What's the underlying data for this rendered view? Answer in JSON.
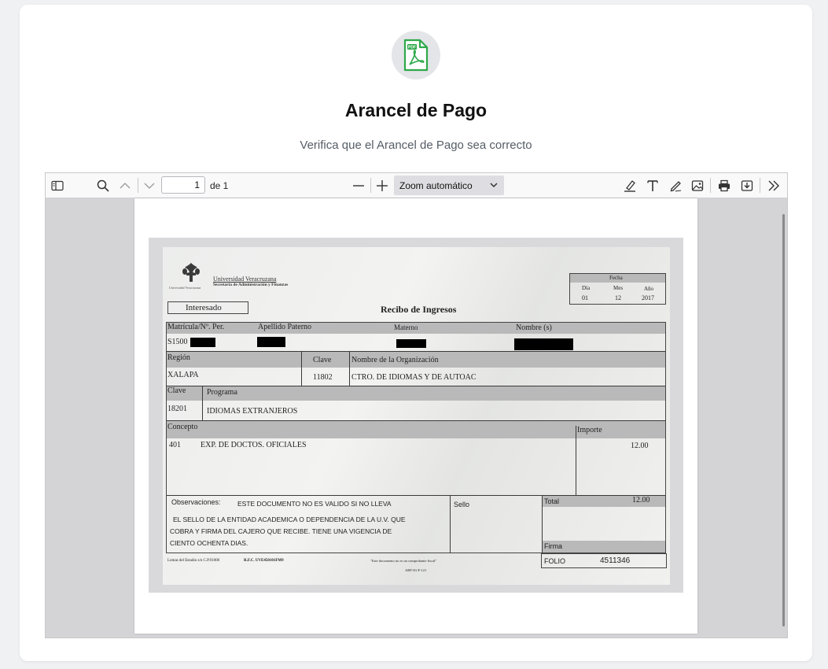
{
  "header": {
    "icon": "pdf-file-icon",
    "title": "Arancel de Pago",
    "subtitle": "Verifica que el Arancel de Pago sea correcto",
    "accent_color": "#2ea84a"
  },
  "viewer": {
    "page_current": "1",
    "page_total_label": "de 1",
    "zoom_label": "Zoom automático",
    "tools": [
      "sidebar-toggle-icon",
      "search-icon",
      "previous-page-icon",
      "next-page-icon",
      "zoom-out-icon",
      "zoom-in-icon",
      "highlight-icon",
      "text-icon",
      "draw-icon",
      "image-icon",
      "print-icon",
      "download-icon",
      "more-tools-icon"
    ]
  },
  "document": {
    "university": "Universidad Veracruzana",
    "department": "Secretaría de Administración y Finanzas",
    "seal_caption": "Universidad Veracruzana",
    "fecha_label": "Fecha",
    "dia_label": "Día",
    "mes_label": "Mes",
    "anio_label": "Año",
    "dia": "01",
    "mes": "12",
    "anio": "2017",
    "interesado": "Interesado",
    "receipt_title": "Recibo de Ingresos",
    "matricula_label": "Matrícula/Nº. Per.",
    "apellido_label": "Apellido Paterno",
    "materno_label": "Materno",
    "nombre_label": "Nombre (s)",
    "matricula_value": "S1500",
    "region_label": "Región",
    "clave_label": "Clave",
    "org_label": "Nombre de la Organización",
    "region_value": "XALAPA",
    "clave_value": "11802",
    "org_value": "CTRO. DE IDIOMAS Y DE AUTOAC",
    "clave2_label": "Clave",
    "programa_label": "Programa",
    "clave2_value": "18201",
    "programa_value": "IDIOMAS EXTRANJEROS",
    "concepto_label": "Concepto",
    "importe_label": "Importe",
    "concepto_code": "401",
    "concepto_value": "EXP. DE DOCTOS. OFICIALES",
    "importe_value": "12.00",
    "obs_label": "Observaciones:",
    "obs_line1": "ESTE DOCUMENTO NO ES VALIDO SI NO LLEVA",
    "obs_line2": "EL SELLO DE LA ENTIDAD ACADEMICA O DEPENDENCIA DE LA U.V. QUE",
    "obs_line3": "COBRA Y FIRMA DEL CAJERO QUE RECIBE. TIENE UNA VIGENCIA DE",
    "obs_line4": "CIENTO OCHENTA DIAS.",
    "sello_label": "Sello",
    "total_label": "Total",
    "total_value": "12.00",
    "firma_label": "Firma",
    "folio_label": "FOLIO",
    "folio_value": "4511346",
    "footer_address": "Lomas del Estadio s/n C.P.91000",
    "footer_rfc": "R.F.C. UVE450101FM9",
    "footer_note": "\"Este documento no es un comprobante fiscal\"",
    "footer_code": "ARF-IG-F-121"
  }
}
